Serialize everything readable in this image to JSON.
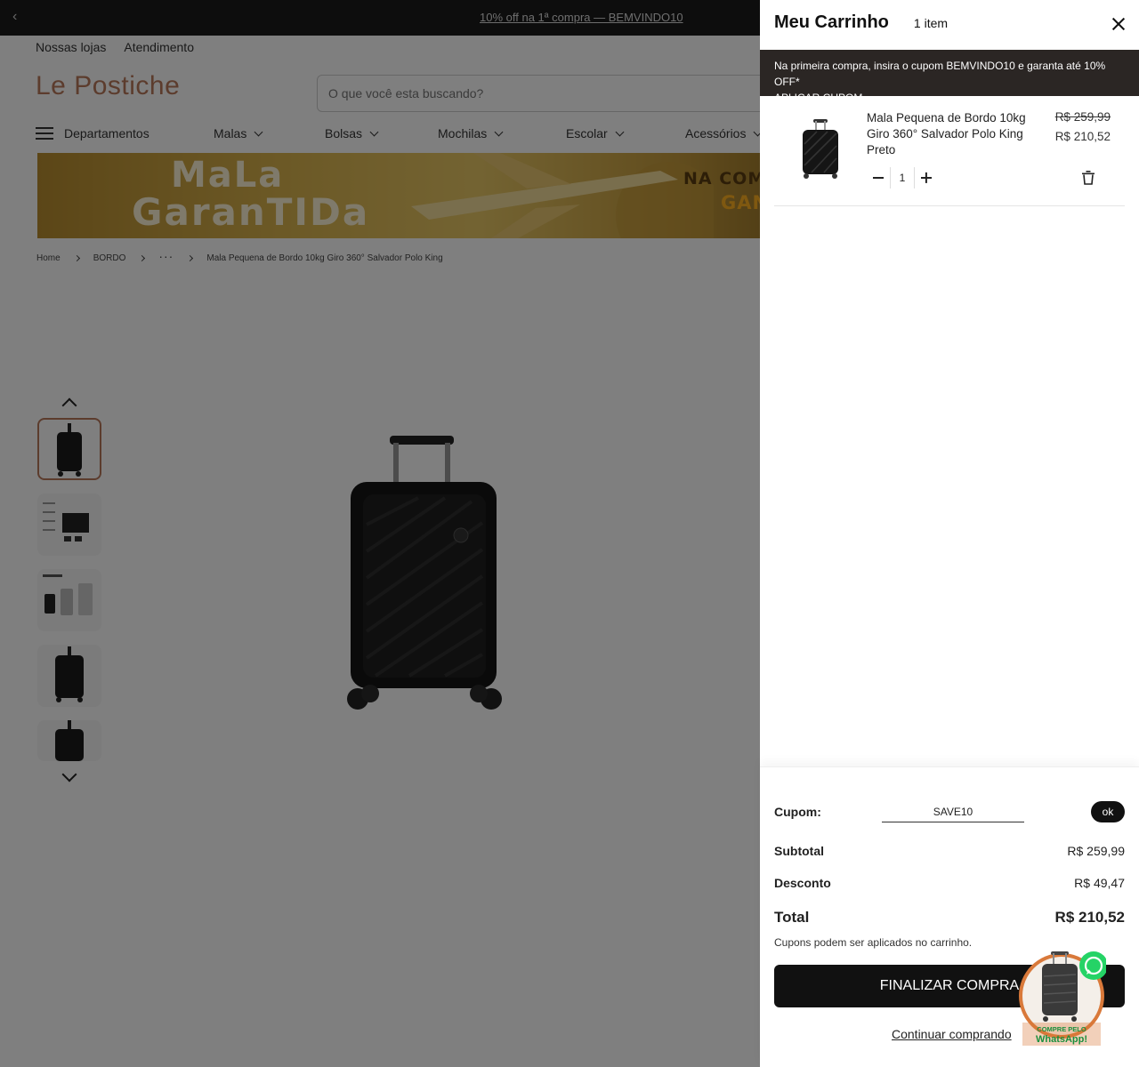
{
  "topbar": {
    "promo": "10% off na 1ª compra — BEMVINDO10"
  },
  "util_links": [
    "Nossas lojas",
    "Atendimento"
  ],
  "logo_text": "Le Postiche",
  "search": {
    "placeholder": "O que você esta buscando?"
  },
  "nav": {
    "departments": "Departamentos",
    "items": [
      "Malas",
      "Bolsas",
      "Mochilas",
      "Escolar",
      "Acessórios"
    ]
  },
  "banner": {
    "line1": "MaLa",
    "line2": "GaranTIDa",
    "line3": "NA COMPR",
    "line4": "GAN"
  },
  "breadcrumb": {
    "home": "Home",
    "category": "BORDO",
    "ellipsis": "···",
    "current": "Mala Pequena de Bordo 10kg Giro 360° Salvador Polo King"
  },
  "cart": {
    "title": "Meu Carrinho",
    "count": "1 item",
    "notice_line1": "Na primeira compra, insira o cupom BEMVINDO10 e garanta até 10% OFF*",
    "notice_line2": "APLICAR CUPOM",
    "item": {
      "name": "Mala Pequena de Bordo 10kg Giro 360° Salvador Polo King Preto",
      "old_price": "R$ 259,99",
      "price": "R$ 210,52",
      "quantity": "1"
    },
    "coupon_label": "Cupom:",
    "coupon_value": "SAVE10",
    "ok_label": "ok",
    "subtotal_label": "Subtotal",
    "subtotal": "R$ 259,99",
    "discount_label": "Desconto",
    "discount": "R$ 49,47",
    "total_label": "Total",
    "total": "R$ 210,52",
    "hint": "Cupons podem ser aplicados no carrinho.",
    "checkout_label": "FINALIZAR COMPRA",
    "continue_label": "Continuar comprando"
  },
  "whatsapp": {
    "line1": "COMPRE PELO",
    "line2": "WhatsApp!"
  },
  "colors": {
    "brand": "#b9785a",
    "dark": "#111111",
    "notice_bg": "#2b2624",
    "whatsapp": "#25d366"
  }
}
